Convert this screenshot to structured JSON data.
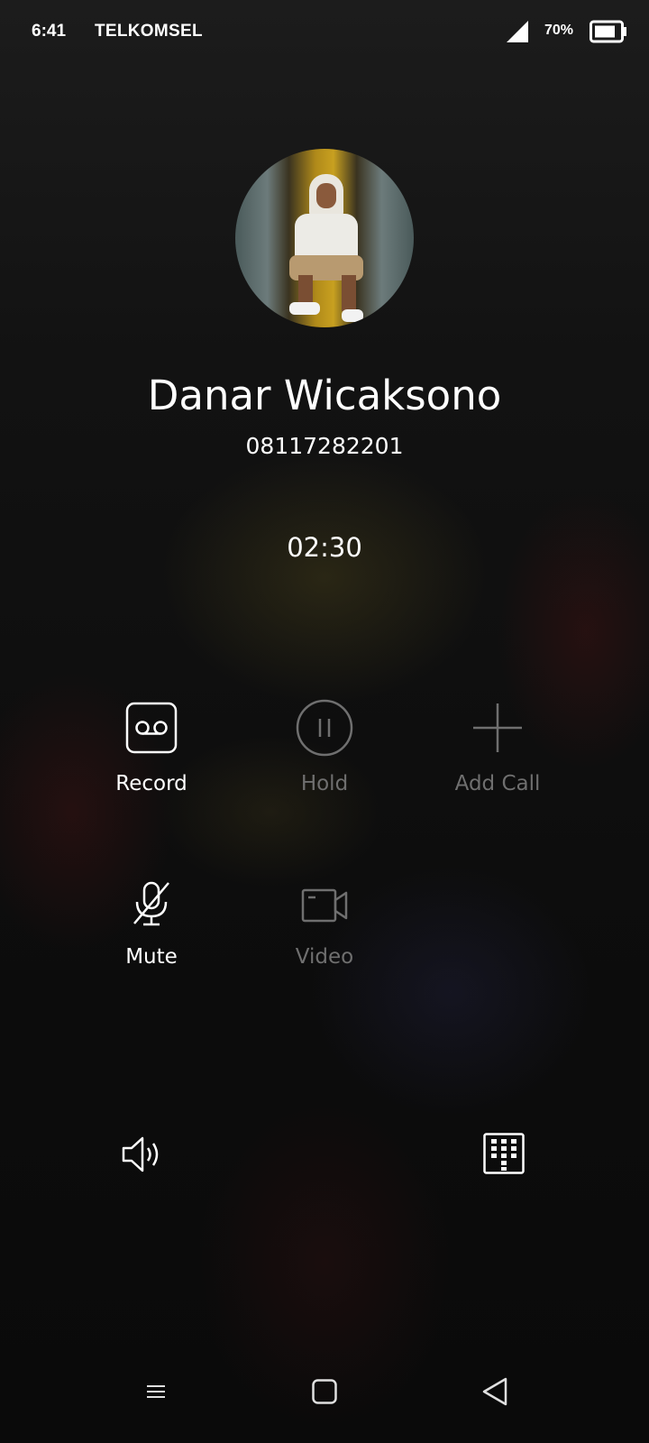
{
  "status_bar": {
    "time": "6:41",
    "carrier": "TELKOMSEL",
    "battery_percent": "70%",
    "signal_icon": "cell-signal-icon",
    "battery_icon": "battery-icon"
  },
  "caller": {
    "name": "Danar Wicaksono",
    "number": "08117282201",
    "avatar": "caller-avatar-photo"
  },
  "call": {
    "duration": "02:30"
  },
  "actions": {
    "record": {
      "label": "Record",
      "icon": "record-icon",
      "enabled": true
    },
    "hold": {
      "label": "Hold",
      "icon": "pause-icon",
      "enabled": false
    },
    "add_call": {
      "label": "Add Call",
      "icon": "plus-icon",
      "enabled": false
    },
    "mute": {
      "label": "Mute",
      "icon": "mic-off-icon",
      "enabled": true
    },
    "video": {
      "label": "Video",
      "icon": "video-camera-icon",
      "enabled": false
    }
  },
  "bottom_controls": {
    "speaker_icon": "speaker-icon",
    "keypad_icon": "keypad-icon"
  },
  "nav_bar": {
    "menu_icon": "menu-icon",
    "home_icon": "home-icon",
    "back_icon": "back-icon"
  },
  "colors": {
    "text_primary": "#ffffff",
    "text_disabled": "#6f6f6f",
    "background": "#111111"
  }
}
